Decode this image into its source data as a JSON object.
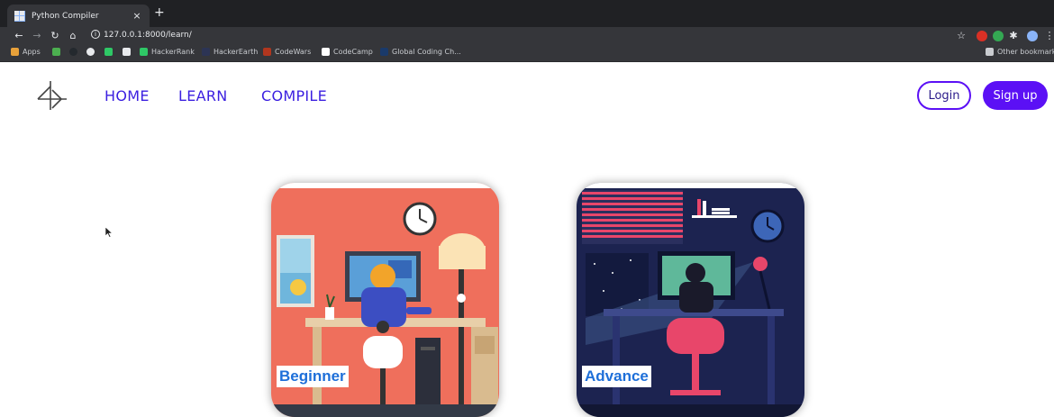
{
  "browser": {
    "tab_title": "Python Compiler",
    "tab_close": "×",
    "new_tab": "+",
    "url": "127.0.0.1:8000/learn/",
    "bookmarks": [
      {
        "label": "Apps",
        "color": "#e8a13a"
      },
      {
        "label": "HackerRank",
        "color": "#2ec866"
      },
      {
        "label": "HackerEarth",
        "color": "#2c3454"
      },
      {
        "label": "CodeWars",
        "color": "#b1361e"
      },
      {
        "label": "CodeCamp",
        "color": "#ffffff"
      },
      {
        "label": "Global Coding Ch...",
        "color": "#1a3a6a"
      }
    ],
    "other_bookmarks": "Other bookmarks"
  },
  "header": {
    "nav": [
      "HOME",
      "LEARN",
      "COMPILE"
    ],
    "login_label": "Login",
    "signup_label": "Sign up",
    "accent_color": "#5b10f5"
  },
  "cards": [
    {
      "label": "Beginner"
    },
    {
      "label": "Advance"
    }
  ]
}
